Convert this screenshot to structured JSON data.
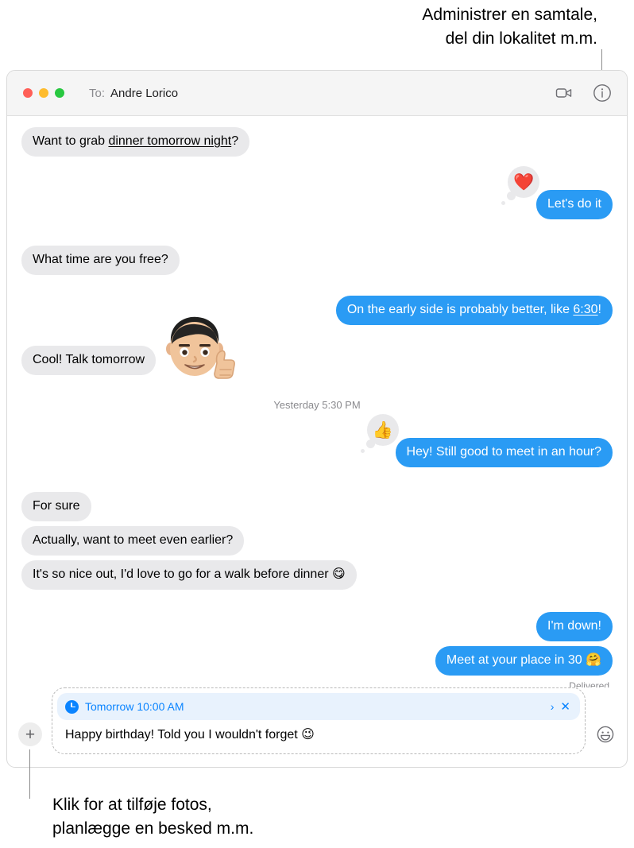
{
  "callouts": {
    "top": "Administrer en samtale,\ndel din lokalitet m.m.",
    "bottom": "Klik for at tilføje fotos,\nplanlægge en besked m.m."
  },
  "window": {
    "titlebar": {
      "to_label": "To:",
      "recipient": "Andre Lorico",
      "facetime_icon": "video-camera-icon",
      "info_icon": "info-circle-icon",
      "traffic_lights": [
        "close",
        "minimize",
        "maximize"
      ]
    }
  },
  "conversation": {
    "timestamp_divider": "Yesterday 5:30 PM",
    "delivered_status": "Delivered",
    "messages": [
      {
        "id": "m1",
        "side": "left",
        "text_before": "Want to grab ",
        "link": "dinner tomorrow night",
        "text_after": "?",
        "tail": true
      },
      {
        "id": "m2",
        "side": "right",
        "text": "Let's do it",
        "tapback": "❤️",
        "tapback_name": "heart-tapback",
        "tail": true
      },
      {
        "id": "m3",
        "side": "left",
        "text": "What time are you free?",
        "tail": true
      },
      {
        "id": "m4",
        "side": "right",
        "text_before": "On the early side is probably better, like ",
        "link": "6:30",
        "text_after": "!",
        "tail": true
      },
      {
        "id": "m5",
        "side": "left",
        "text": "Cool! Talk tomorrow",
        "sticker": "🧑",
        "sticker_name": "memoji-thumbs-up-sticker",
        "tail": true
      },
      {
        "id": "m6",
        "side": "right",
        "text": "Hey! Still good to meet in an hour?",
        "tapback": "👍",
        "tapback_name": "thumbs-up-tapback",
        "tail": true
      },
      {
        "id": "m7",
        "side": "left",
        "text": "For sure",
        "tail": false
      },
      {
        "id": "m8",
        "side": "left",
        "text": "Actually, want to meet even earlier?",
        "tail": false
      },
      {
        "id": "m9",
        "side": "left",
        "text": "It's so nice out, I'd love to go for a walk before dinner 😋",
        "tail": true
      },
      {
        "id": "m10",
        "side": "right",
        "text": "I'm down!",
        "tail": false
      },
      {
        "id": "m11",
        "side": "right",
        "text": "Meet at your place in 30 🤗",
        "tail": true
      }
    ]
  },
  "compose": {
    "add_button_glyph": "+",
    "emoji_button_name": "emoji-smiley-icon",
    "schedule_chip": {
      "label": "Tomorrow 10:00 AM",
      "chevron": "›",
      "close": "✕",
      "clock_icon": "clock-icon"
    },
    "draft_text": "Happy birthday! Told you I wouldn't forget 😉"
  },
  "colors": {
    "outgoing_bubble": "#2a9bf4",
    "incoming_bubble": "#e9e9eb",
    "accent_blue": "#0a84ff",
    "chip_background": "#e8f2fd",
    "titlebar": "#f5f5f5",
    "traffic_close": "#ff5f57",
    "traffic_min": "#febc2e",
    "traffic_max": "#28c840"
  }
}
